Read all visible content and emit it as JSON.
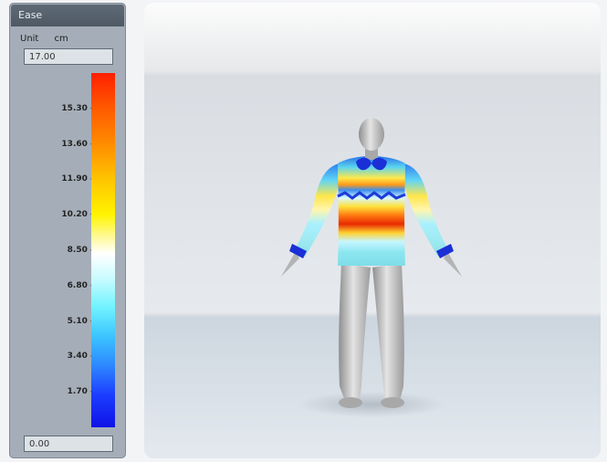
{
  "panel": {
    "title": "Ease",
    "unit_label": "Unit",
    "unit_value": "cm",
    "max_value": "17.00",
    "min_value": "0.00"
  },
  "scale": {
    "ticks": [
      "15.30",
      "13.60",
      "11.90",
      "10.20",
      "8.50",
      "6.80",
      "5.10",
      "3.40",
      "1.70"
    ],
    "colors": {
      "high": "#ff1f00",
      "mid_high": "#fff400",
      "middle": "#ffffff",
      "mid_low": "#72f3ff",
      "low": "#0f12e6"
    }
  },
  "viewport": {
    "model": "avatar-with-sweater"
  }
}
